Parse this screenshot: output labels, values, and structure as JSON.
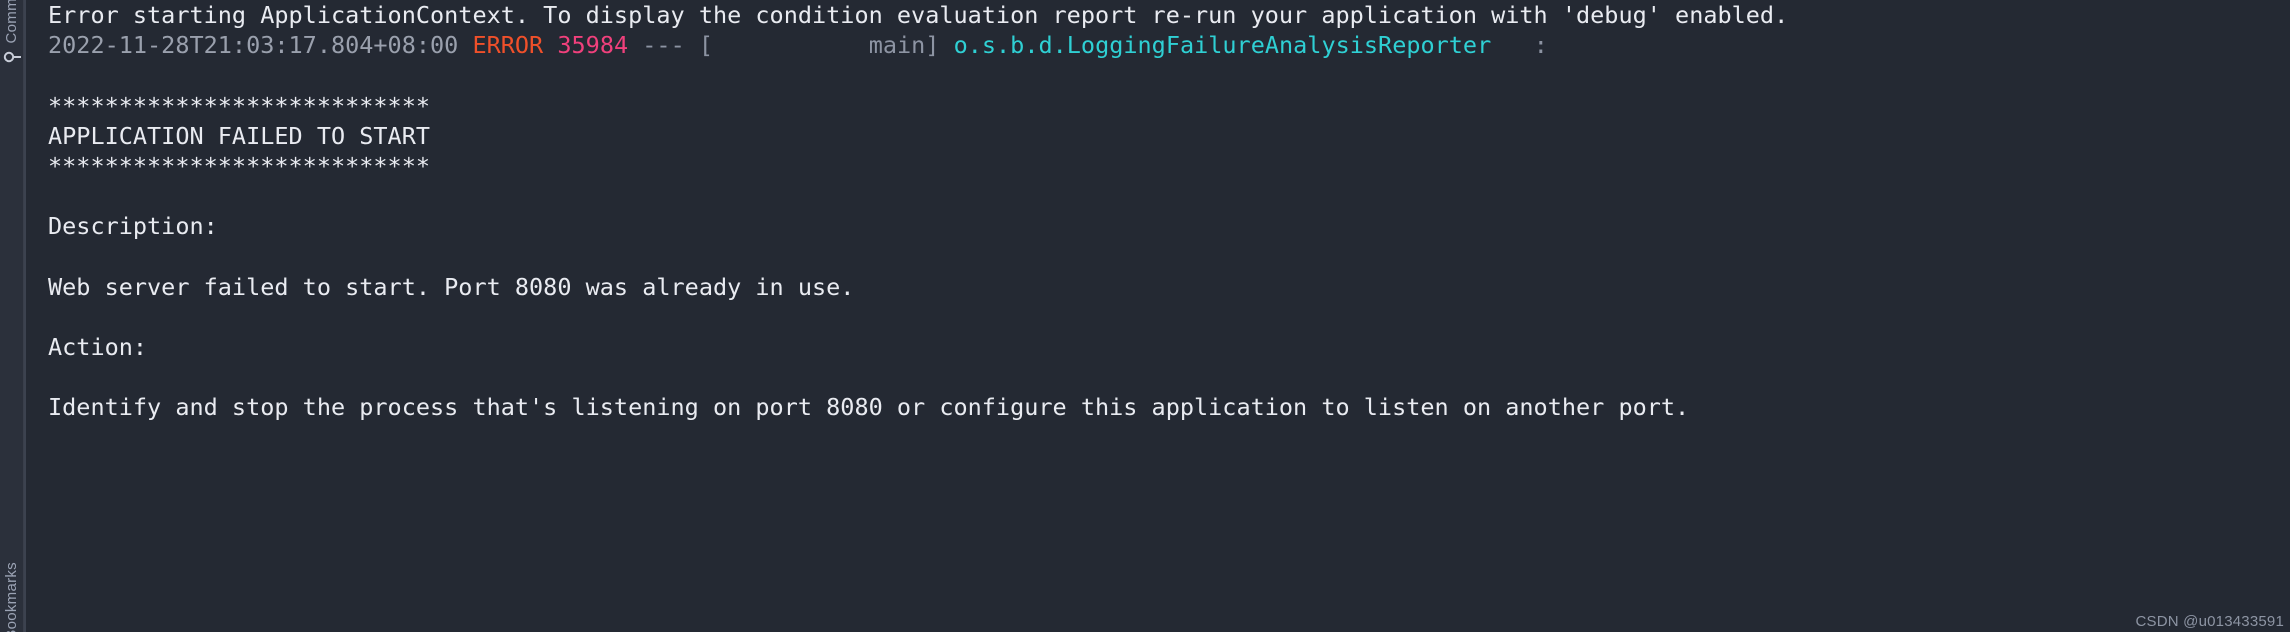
{
  "window": {
    "background_color": "#242933",
    "panel_color": "#2b303b"
  },
  "sidebar": {
    "tabs": [
      {
        "label": "Commit",
        "icon": "git-commit-icon",
        "position": "top"
      },
      {
        "label": "Bookmarks",
        "icon": "bookmark-icon",
        "position": "bottom"
      }
    ]
  },
  "console": {
    "header_line": "Error starting ApplicationContext. To display the condition evaluation report re-run your application with 'debug' enabled.",
    "log_entry": {
      "timestamp": "2022-11-28T21:03:17.804+08:00",
      "level": "ERROR",
      "pid": "35984",
      "separator": "---",
      "thread_open": "[",
      "thread": "main",
      "thread_close": "]",
      "logger": "o.s.b.d.LoggingFailureAnalysisReporter",
      "message_colon": ":"
    },
    "banner_top": "***************************",
    "banner_title": "APPLICATION FAILED TO START",
    "banner_bottom": "***************************",
    "description_label": "Description:",
    "description_text": "Web server failed to start. Port 8080 was already in use.",
    "action_label": "Action:",
    "action_text": "Identify and stop the process that's listening on port 8080 or configure this application to listen on another port.",
    "colors": {
      "text": "#e9ebf1",
      "timestamp": "#9aa0ad",
      "error_level": "#f0502a",
      "pid": "#f0407c",
      "logger": "#2fd0d4"
    }
  },
  "watermark": {
    "text": "CSDN @u013433591"
  }
}
